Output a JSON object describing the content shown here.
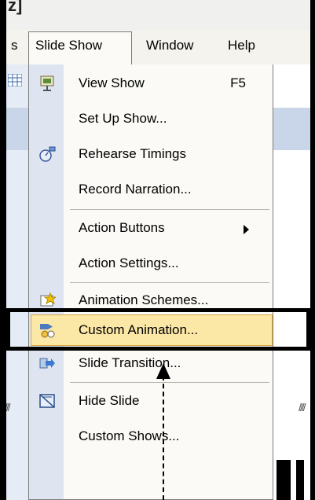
{
  "title_fragment": "z]",
  "menubar": {
    "items": [
      {
        "label": "s"
      },
      {
        "label": "Slide Show"
      },
      {
        "label": "Window"
      },
      {
        "label": "Help"
      }
    ]
  },
  "menu": {
    "items": [
      {
        "label": "View Show",
        "shortcut": "F5",
        "icon": "projector-screen-icon"
      },
      {
        "label": "Set Up Show..."
      },
      {
        "label": "Rehearse Timings",
        "icon": "stopwatch-icon"
      },
      {
        "label": "Record Narration..."
      },
      {
        "label": "Action Buttons"
      },
      {
        "label": "Action Settings..."
      },
      {
        "label": "Animation Schemes...",
        "icon": "animation-schemes-icon"
      },
      {
        "label": "Custom Animation...",
        "icon": "custom-animation-icon",
        "highlighted": true
      },
      {
        "label": "Slide Transition...",
        "icon": "slide-transition-icon"
      },
      {
        "label": "Hide Slide",
        "icon": "hide-slide-icon"
      },
      {
        "label": "Custom Shows..."
      }
    ]
  },
  "colors": {
    "menu_bg": "#fbfaf6",
    "gutter": "#dfe5f0",
    "highlight": "#fce8a6",
    "highlight_border": "#d9a640",
    "callout": "#000000"
  }
}
